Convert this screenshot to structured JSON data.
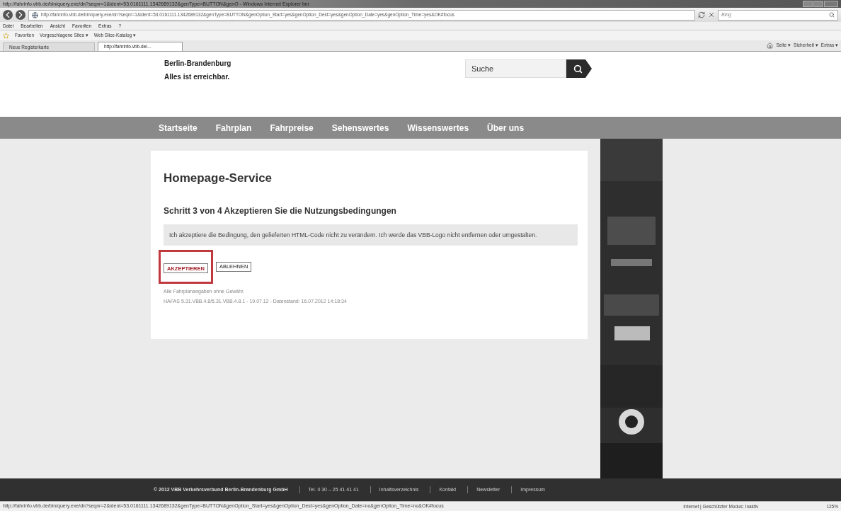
{
  "window": {
    "title": "http://fahrinfo.vbb.de/bin/query.exe/dn?seqnr=1&ident=53.0161111.1342689132&genType=BUTTON&genO - Windows Internet Explorer ber"
  },
  "address_bar": {
    "url": "http://fahrinfo.vbb.de/bin/query.exe/dn?seqnr=1&ident=53.0161111.1342689132&genType=BUTTON&genOption_Start=yes&genOption_Dest=yes&genOption_Date=yes&genOption_Time=yes&OK#focus",
    "search_placeholder": "Bing"
  },
  "menu": [
    "Datei",
    "Bearbeiten",
    "Ansicht",
    "Favoriten",
    "Extras",
    "?"
  ],
  "favorites_bar": [
    {
      "label": "Favoriten"
    },
    {
      "label": "Vorgeschlagene Sites ▾"
    },
    {
      "label": "Web Slice-Katalog ▾"
    }
  ],
  "tabs": [
    {
      "label": "Neue Registerkarte",
      "selected": false
    },
    {
      "label": "http://fahrinfo.vbb.de/...",
      "selected": true
    }
  ],
  "command_bar": [
    "Seite ▾",
    "Sicherheit ▾",
    "Extras ▾"
  ],
  "header": {
    "lines": [
      "Berlin-Brandenburg",
      "Alles ist erreichbar."
    ],
    "search_placeholder": "Suche"
  },
  "nav": [
    "Startseite",
    "Fahrplan",
    "Fahrpreise",
    "Sehenswertes",
    "Wissenswertes",
    "Über uns"
  ],
  "content": {
    "title": "Homepage-Service",
    "step": "Schritt 3 von 4 Akzeptieren Sie die Nutzungsbedingungen",
    "terms": "Ich akzeptiere die Bedingung, den gelieferten HTML-Code nicht zu verändern. Ich werde das VBB-Logo nicht entfernen oder umgestalten.",
    "buttons": [
      {
        "label": "AKZEPTIEREN",
        "selected": true
      },
      {
        "label": "ABLEHNEN",
        "selected": false
      }
    ],
    "notes": [
      "Alle Fahrplanangaben ohne Gewähr.",
      "HAFAS 5.31.VBB.4.8/5.31.VBB.4.8.1 - 19.07.12 - Datenstand: 16.07.2012 14:18:34"
    ]
  },
  "footer": {
    "copyright": "© 2012 VBB Verkehrsverbund Berlin-Brandenburg GmbH",
    "links": [
      "Tel. 0 30 – 25 41 41 41",
      "Inhaltsverzeichnis",
      "Kontakt",
      "Newsletter",
      "Impressum"
    ]
  },
  "status_bar": {
    "url": "http://fahrinfo.vbb.de/bin/query.exe/dn?seqnr=2&ident=53.0161111.1342689132&genType=BUTTON&genOption_Start=yes&genOption_Dest=yes&genOption_Date=no&genOption_Time=no&OK#focus",
    "zone": "Internet | Geschützter Modus: Inaktiv",
    "zoom": "125%"
  }
}
